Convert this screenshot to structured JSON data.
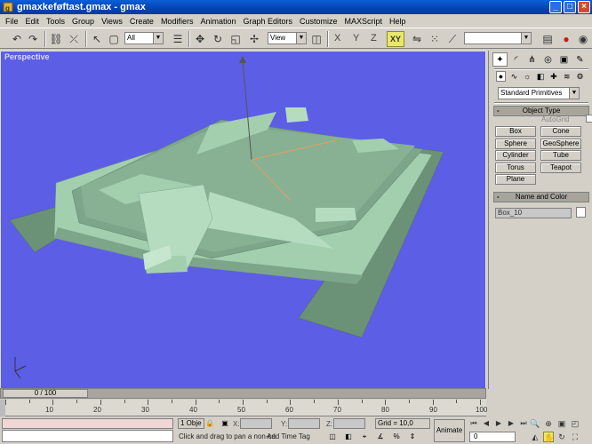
{
  "window": {
    "title": "gmaxkeføftast.gmax - gmax",
    "minimize_glyph": "_",
    "maximize_glyph": "□",
    "close_glyph": "×"
  },
  "menu": [
    "File",
    "Edit",
    "Tools",
    "Group",
    "Views",
    "Create",
    "Modifiers",
    "Animation",
    "Graph Editors",
    "Customize",
    "MAXScript",
    "Help"
  ],
  "toolbar": {
    "selection_filter": "All",
    "reference_coord": "View",
    "axis_x": "X",
    "axis_y": "Y",
    "axis_z": "Z",
    "axis_xy": "XY",
    "named_selection": ""
  },
  "viewport": {
    "label": "Perspective",
    "background": "#5c5ee6",
    "model_color": "#7da58a"
  },
  "command_panel": {
    "category_dropdown": "Standard Primitives",
    "object_type_title": "Object Type",
    "autogrid_label": "AutoGrid",
    "object_buttons": [
      "Box",
      "Cone",
      "Sphere",
      "GeoSphere",
      "Cylinder",
      "Tube",
      "Torus",
      "Teapot",
      "Plane"
    ],
    "name_color_title": "Name and Color",
    "object_name": "Box_10",
    "rollout_minus": "-"
  },
  "timeline": {
    "frame_display": "0 / 100",
    "ticks": [
      "10",
      "20",
      "30",
      "40",
      "50",
      "60",
      "70",
      "80",
      "90",
      "100"
    ]
  },
  "status": {
    "selection_count": "1 Obje",
    "x_label": "X:",
    "y_label": "Y:",
    "z_label": "Z:",
    "grid": "Grid = 10,0",
    "prompt": "Click and drag to pan a non-ca",
    "time_tag": "Add Time Tag",
    "animate": "Animate",
    "current_frame": "0"
  }
}
